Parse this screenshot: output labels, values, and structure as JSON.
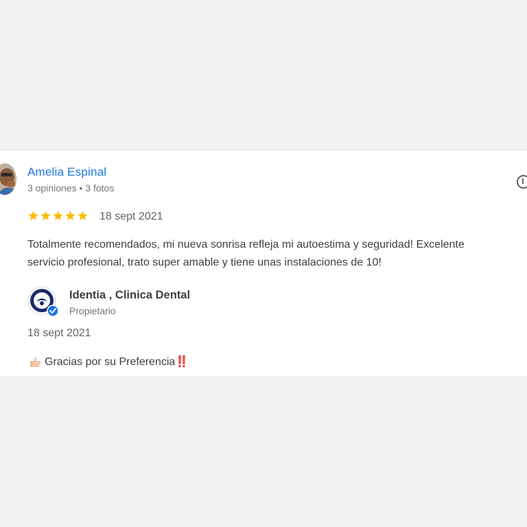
{
  "review": {
    "reviewer_name": "Amelia Espinal",
    "reviewer_meta": "3 opiniones • 3 fotos",
    "rating": 5,
    "rating_max": 5,
    "date": "18 sept 2021",
    "text": "Totalmente recomendados, mi nueva sonrisa refleja mi autoestima y seguridad! Excelente\nservicio profesional, trato super amable y tiene unas instalaciones de 10!"
  },
  "owner_reply": {
    "owner_name": "Identia , Clinica Dental",
    "owner_role": "Propietario",
    "date": "18 sept 2021",
    "text": "Gracias por su Preferencia‼️",
    "reaction_icon": "thumbs-up-icon"
  },
  "colors": {
    "link_blue": "#1a73e8",
    "star_yellow": "#fbbc04",
    "verified_blue": "#1a73e8",
    "logo_navy": "#1b2a6b",
    "page_bg": "#f1f1f1"
  },
  "icons": {
    "flag": "flag-icon",
    "star": "star-icon",
    "verified": "verified-badge-icon"
  }
}
